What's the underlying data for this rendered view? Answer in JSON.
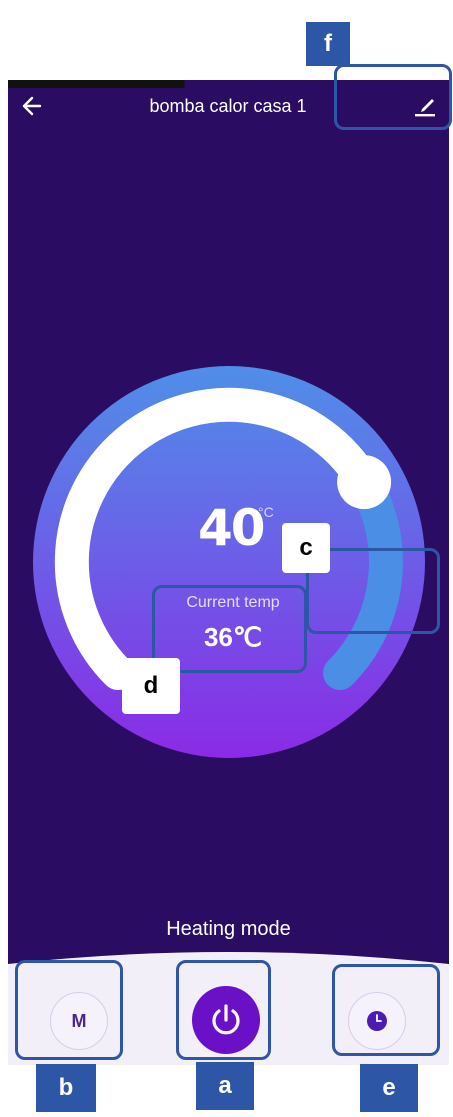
{
  "header": {
    "title": "bomba calor casa 1",
    "back_icon": "arrow-left-icon",
    "edit_icon": "pencil-icon"
  },
  "thermostat": {
    "setpoint_value": "40",
    "setpoint_unit": "°C",
    "current_label": "Current temp",
    "current_value": "36℃",
    "setpoint_level": 0.72
  },
  "mode": {
    "label": "Heating mode"
  },
  "bottom_bar": {
    "mode_button_label": "M",
    "power_icon": "power-icon",
    "timer_icon": "clock-icon"
  },
  "callouts": {
    "a": "a",
    "b": "b",
    "c": "c",
    "d": "d",
    "e": "e",
    "f": "f"
  },
  "colors": {
    "background": "#2a0d63",
    "dial_top": "#4f8fe8",
    "dial_bottom": "#8a2be6",
    "power_button": "#6a10c7",
    "callout": "#2e56a6"
  }
}
